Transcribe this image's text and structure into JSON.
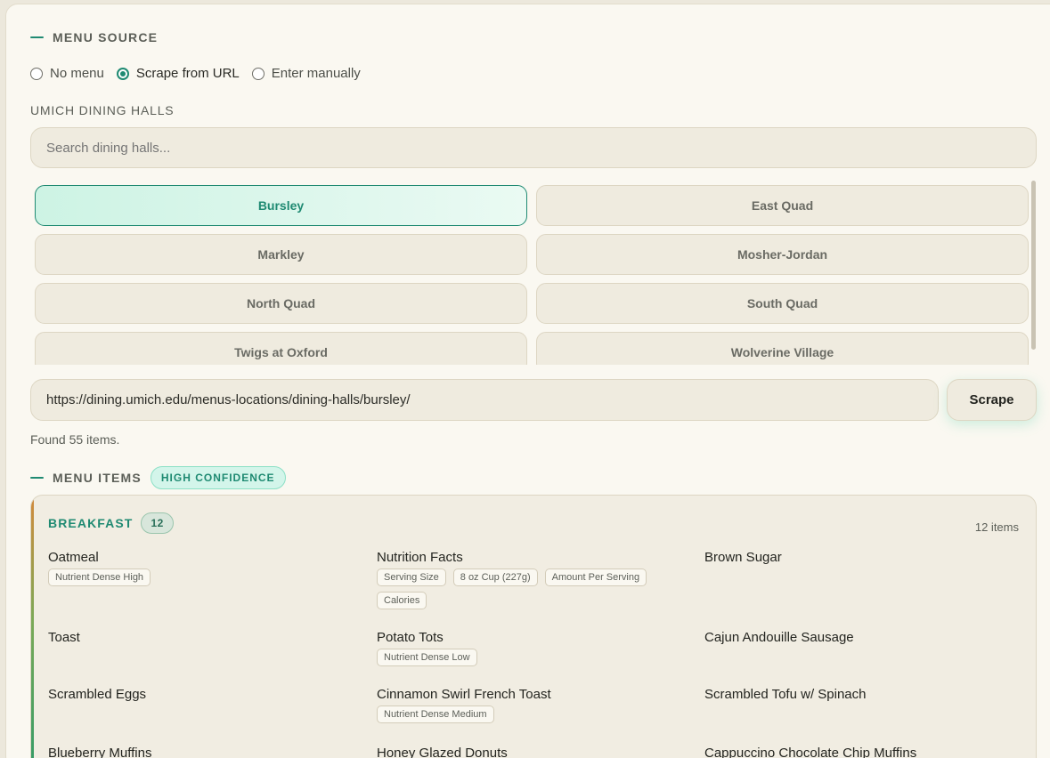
{
  "menu_source": {
    "title": "MENU SOURCE",
    "options": [
      "No menu",
      "Scrape from URL",
      "Enter manually"
    ],
    "selected": "Scrape from URL"
  },
  "dining_halls": {
    "label": "UMICH DINING HALLS",
    "search_placeholder": "Search dining halls...",
    "halls": [
      "Bursley",
      "East Quad",
      "Markley",
      "Mosher-Jordan",
      "North Quad",
      "South Quad",
      "Twigs at Oxford",
      "Wolverine Village"
    ],
    "selected": "Bursley"
  },
  "url_input": {
    "value": "https://dining.umich.edu/menus-locations/dining-halls/bursley/"
  },
  "scrape_button": {
    "label": "Scrape"
  },
  "status_text": "Found 55 items.",
  "menu_items": {
    "title": "MENU ITEMS",
    "confidence": "HIGH CONFIDENCE",
    "category": {
      "name": "BREAKFAST",
      "count": "12",
      "items_total": "12 items",
      "items": [
        {
          "name": "Oatmeal",
          "tags": [
            "Nutrient Dense High"
          ]
        },
        {
          "name": "Nutrition Facts",
          "tags": [
            "Serving Size",
            "8 oz Cup (227g)",
            "Amount Per Serving",
            "Calories"
          ]
        },
        {
          "name": "Brown Sugar",
          "tags": []
        },
        {
          "name": "Toast",
          "tags": []
        },
        {
          "name": "Potato Tots",
          "tags": [
            "Nutrient Dense Low"
          ]
        },
        {
          "name": "Cajun Andouille Sausage",
          "tags": []
        },
        {
          "name": "Scrambled Eggs",
          "tags": []
        },
        {
          "name": "Cinnamon Swirl French Toast",
          "tags": [
            "Nutrient Dense Medium"
          ]
        },
        {
          "name": "Scrambled Tofu w/ Spinach",
          "tags": []
        },
        {
          "name": "Blueberry Muffins",
          "tags": []
        },
        {
          "name": "Honey Glazed Donuts",
          "tags": []
        },
        {
          "name": "Cappuccino Chocolate Chip Muffins",
          "tags": []
        }
      ]
    }
  },
  "colors": {
    "accent": "#1f8a72",
    "panel_bg": "#faf8f1",
    "field_bg": "#efebdf"
  }
}
